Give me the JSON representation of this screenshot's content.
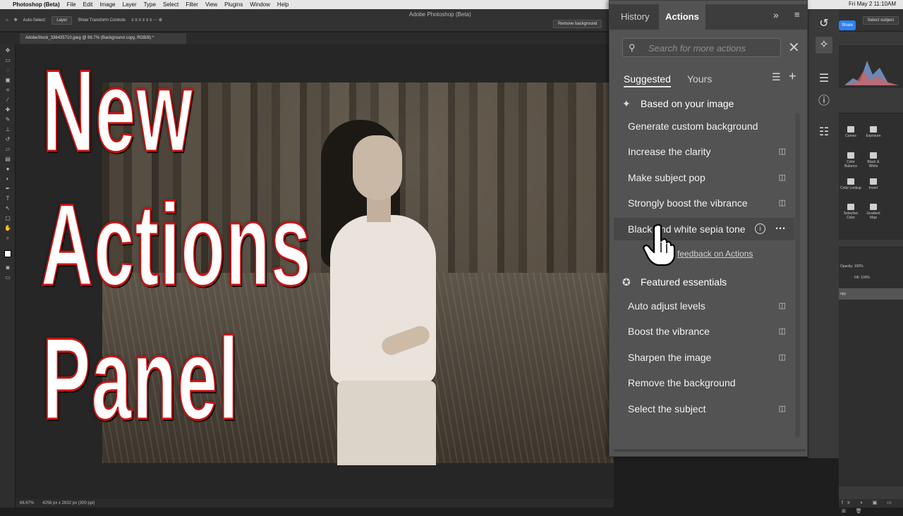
{
  "menubar": {
    "app": "Photoshop (Beta)",
    "items": [
      "File",
      "Edit",
      "Image",
      "Layer",
      "Type",
      "Select",
      "Filter",
      "View",
      "Plugins",
      "Window",
      "Help"
    ],
    "clock": "Fri May 2  11:10AM"
  },
  "options_bar": {
    "auto_select": "Auto-Select:",
    "auto_select_value": "Layer",
    "show_transform": "Show Transform Controls",
    "select_subject": "Select subject",
    "remove_background": "Remove background",
    "share": "Share"
  },
  "window_title": "Adobe Photoshop (Beta)",
  "document_tab": "AdobeStock_336435710.jpeg @ 66.7% (Background copy, RGB/8) *",
  "overlay_text": {
    "line1": "New",
    "line2": "Actions",
    "line3": "Panel"
  },
  "status": {
    "zoom": "66.67%",
    "info": "4256 px x 2832 px (300 ppi)"
  },
  "panel": {
    "tabs": {
      "history": "History",
      "actions": "Actions"
    },
    "search_placeholder": "Search for more actions",
    "subtabs": {
      "suggested": "Suggested",
      "yours": "Yours"
    },
    "section1": "Based on your image",
    "suggested_actions": [
      "Generate custom background",
      "Increase the clarity",
      "Make subject pop",
      "Strongly boost the vibrance",
      "Black and white sepia tone"
    ],
    "feedback": "feedback on Actions",
    "section2": "Featured essentials",
    "essential_actions": [
      "Auto adjust levels",
      "Boost the vibrance",
      "Sharpen the image",
      "Remove the background",
      "Select the subject"
    ]
  },
  "dock": {
    "adjustments": [
      "Curves",
      "Exposure",
      "Color Balance",
      "Black & White",
      "Color Lookup",
      "Invert",
      "Selective Color",
      "Gradient Map"
    ],
    "opacity_label": "Opacity:",
    "opacity_value": "100%",
    "fill_label": "Fill:",
    "fill_value": "100%",
    "layer_name": "opy"
  },
  "icons": {
    "search": "search-icon",
    "close": "close-icon",
    "sort": "sort-icon",
    "add": "add-icon",
    "sparkle": "sparkle-icon",
    "badge": "badge-icon",
    "eye": "preview-icon",
    "info": "info-icon",
    "more": "more-icon",
    "hand": "hand-cursor-icon"
  },
  "colors": {
    "panel_bg": "#535353",
    "title_text_stroke": "#c81414",
    "share_button": "#2d7ff9"
  }
}
